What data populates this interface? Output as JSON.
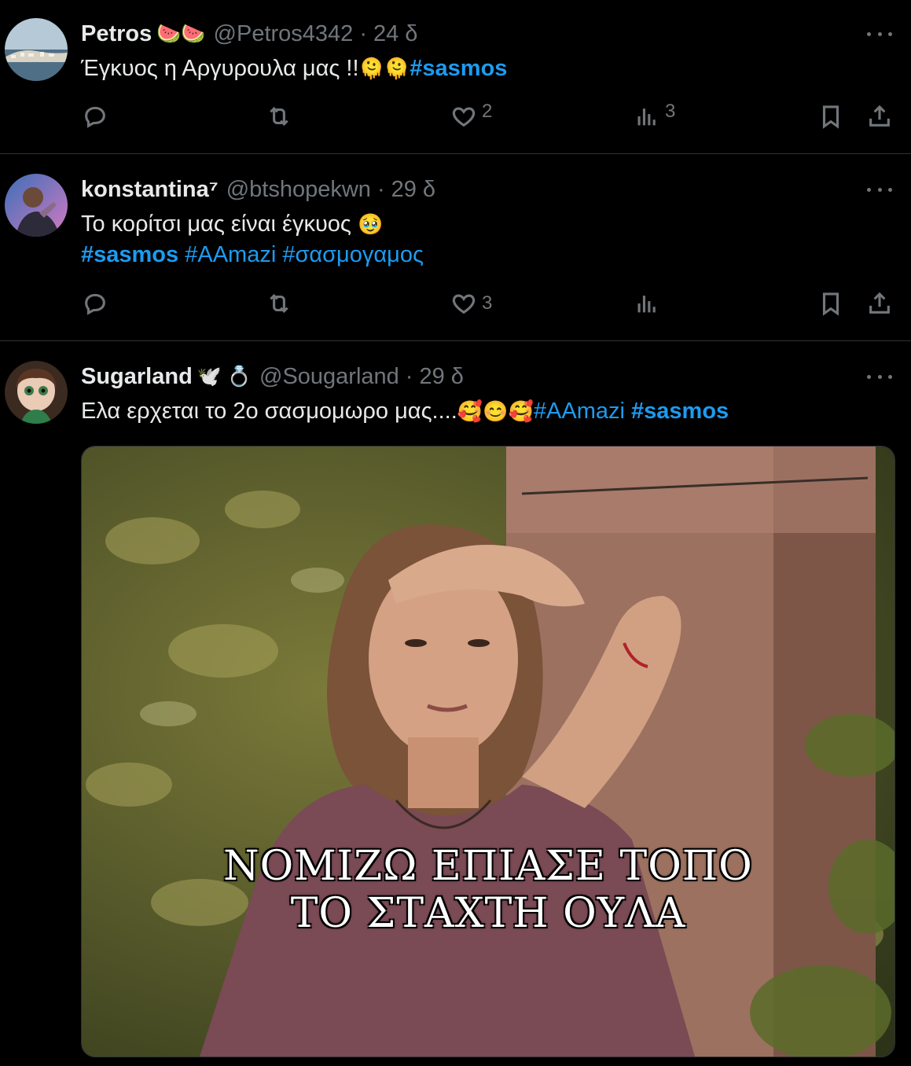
{
  "tweets": [
    {
      "name": "Petros",
      "deco": "🍉🍉",
      "handle": "@Petros4342",
      "separator": "·",
      "time": "24 δ",
      "text": "Έγκυος η Αργυρουλα μας !!",
      "emojis": "🫠🫠",
      "hashtags": [
        "#sasmos"
      ],
      "counts": {
        "reply": "",
        "retweet": "",
        "like": "2",
        "views": "3"
      }
    },
    {
      "name": "konstantina⁷",
      "deco": "",
      "handle": "@btshopekwn",
      "separator": "·",
      "time": "29 δ",
      "text": "Το κορίτσι μας είναι έγκυος",
      "emojis": "🥹",
      "hashtags": [
        "#sasmos",
        "#AAmazi",
        "#σασμογαμος"
      ],
      "counts": {
        "reply": "",
        "retweet": "",
        "like": "3",
        "views": ""
      }
    },
    {
      "name": "Sugarland",
      "deco": "🕊️ 💍",
      "handle": "@Sougarland",
      "separator": "·",
      "time": "29 δ",
      "text": "Ελα ερχεται το 2ο σασμομωρο μας....",
      "emojis": "🥰😊🥰",
      "hashtags": [
        "#AAmazi",
        "#sasmos"
      ],
      "media_caption_line1": "ΝΟΜΙΖΩ ΕΠΙΑΣΕ ΤΟΠΟ",
      "media_caption_line2": "ΤΟ ΣΤΑΧΤΗ ΟΥΛΑ"
    }
  ],
  "colors": {
    "background": "#000000",
    "text": "#e7e9ea",
    "secondary": "#71767b",
    "accent": "#1d9bf0",
    "divider": "#2f3336"
  },
  "icons": [
    "reply-icon",
    "retweet-icon",
    "like-icon",
    "views-icon",
    "bookmark-icon",
    "share-icon",
    "more-icon"
  ]
}
